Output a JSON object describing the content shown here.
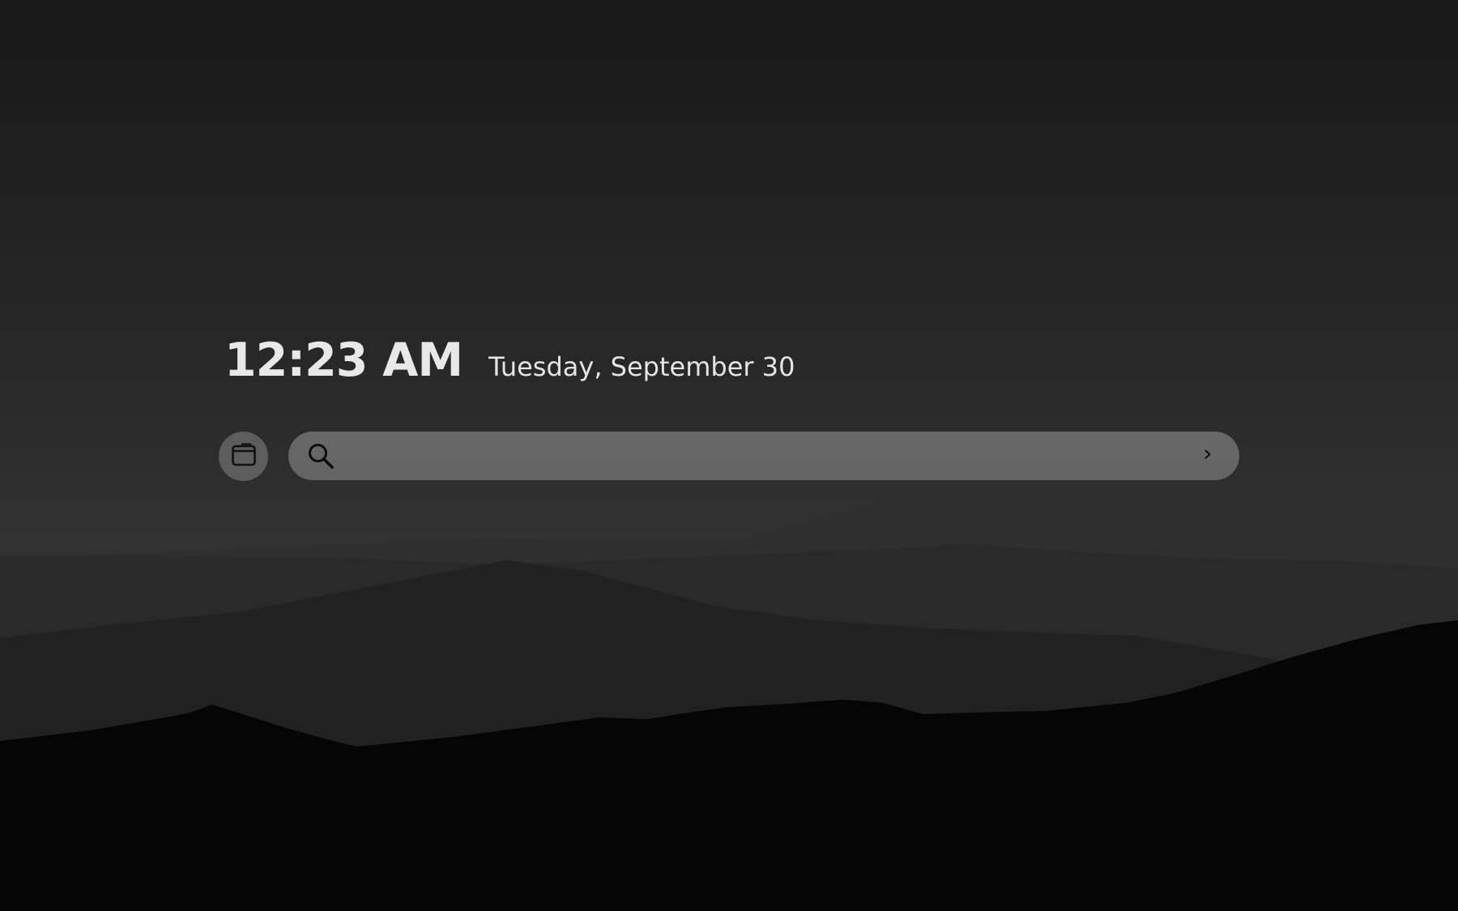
{
  "clock": {
    "time": "12:23 AM",
    "date": "Tuesday, September 30"
  },
  "tab_button": {
    "icon": "browser-window-icon"
  },
  "search": {
    "icon": "search-icon",
    "value": "",
    "placeholder": "",
    "submit_icon": "chevron-right-icon"
  },
  "colors": {
    "text": "#e8e8e8",
    "search_bar": "#666666",
    "tab_button": "#5d5d5d"
  }
}
